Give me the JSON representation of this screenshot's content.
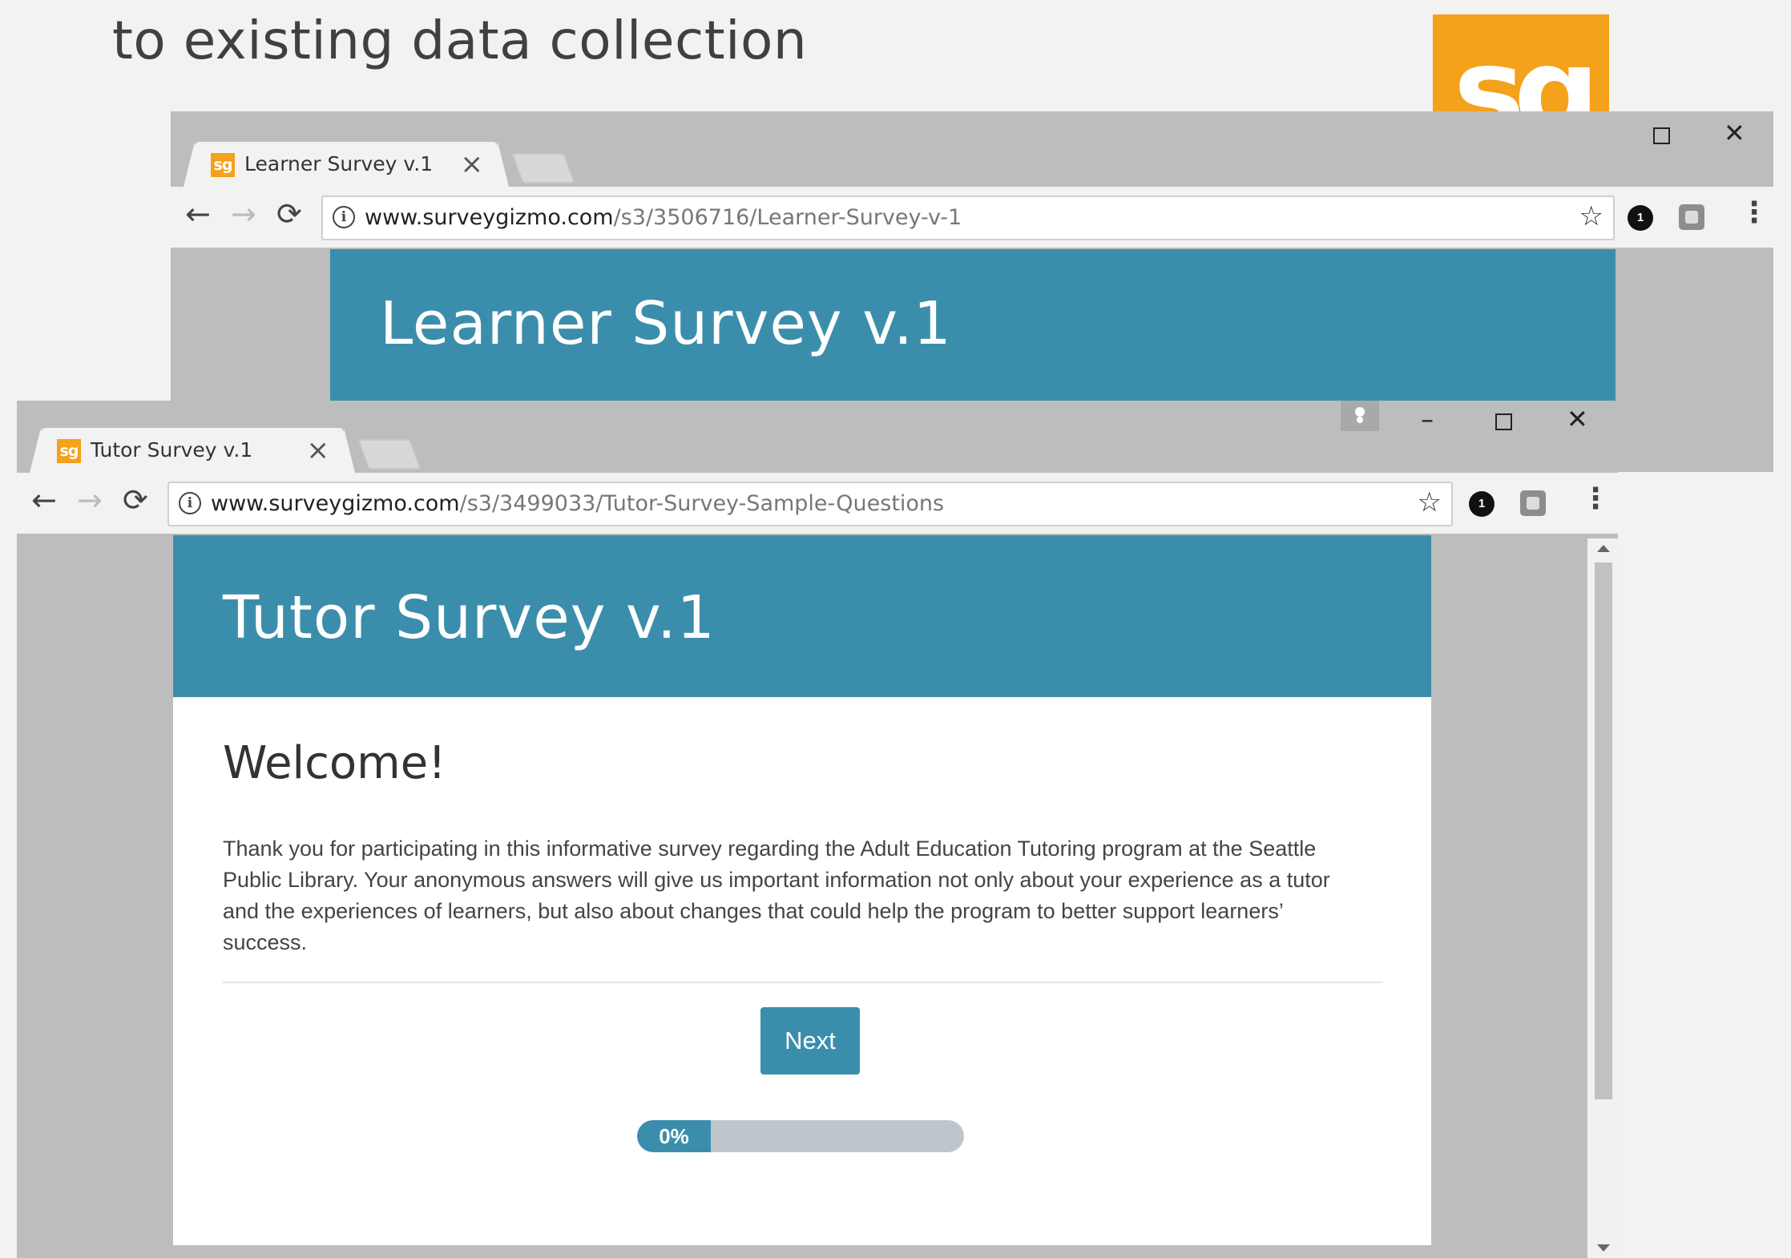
{
  "slide": {
    "title_line": "to existing data collection"
  },
  "logo": {
    "text": "sg",
    "color": "#f4a11b"
  },
  "back_window": {
    "tab": {
      "favicon": "sg",
      "title": "Learner Survey v.1",
      "close": "×"
    },
    "url": {
      "host": "www.surveygizmo.com",
      "path": "/s3/3506716/Learner-Survey-v-1"
    },
    "banner_title": "Learner Survey v.1",
    "extension_badge": "1"
  },
  "front_window": {
    "tab": {
      "favicon": "sg",
      "title": "Tutor Survey v.1",
      "close": "×"
    },
    "url": {
      "host": "www.surveygizmo.com",
      "path": "/s3/3499033/Tutor-Survey-Sample-Questions"
    },
    "banner_title": "Tutor Survey v.1",
    "extension_badge": "1",
    "survey": {
      "heading": "Welcome!",
      "intro": "Thank you for participating in this informative survey regarding the Adult Education Tutoring program at the Seattle Public Library. Your anonymous answers will give us important information not only about your experience as a tutor and the experiences of learners, but also about changes that could help the program to better support learners’ success.",
      "next_label": "Next",
      "progress_label": "0%",
      "progress_value": 0
    }
  },
  "controls": {
    "minimize": "–",
    "close": "✕",
    "back": "←",
    "forward": "→",
    "reload": "⟳",
    "menu": "⋮",
    "star": "☆",
    "info": "i"
  },
  "colors": {
    "banner": "#3b8eab",
    "chrome": "#bdbdbd",
    "tab": "#f2f2f2",
    "progress_track": "#bec6cc"
  }
}
